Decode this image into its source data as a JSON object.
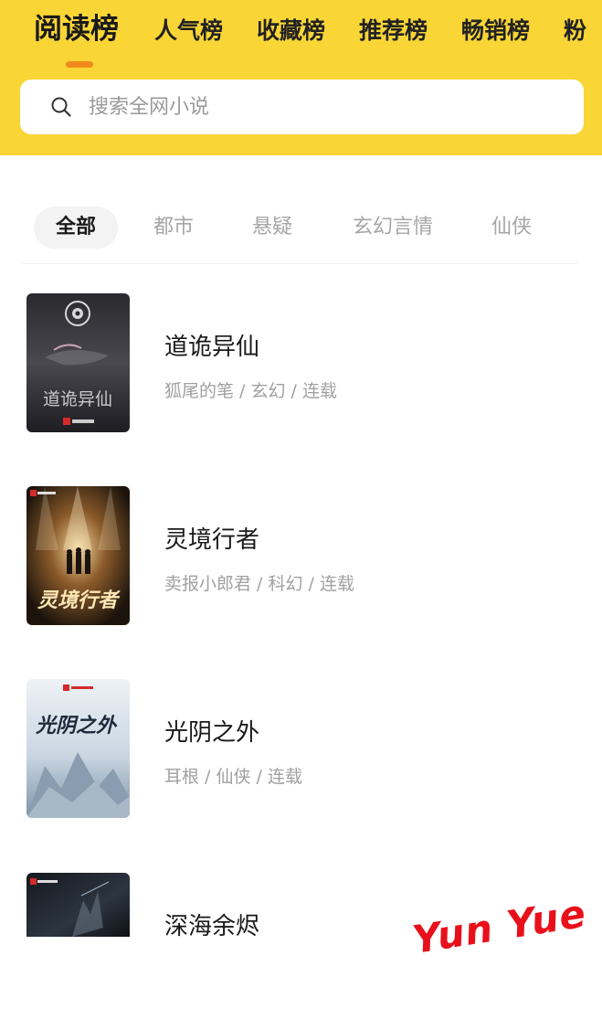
{
  "top_tabs": [
    {
      "label": "阅读榜",
      "active": true
    },
    {
      "label": "人气榜",
      "active": false
    },
    {
      "label": "收藏榜",
      "active": false
    },
    {
      "label": "推荐榜",
      "active": false
    },
    {
      "label": "畅销榜",
      "active": false
    },
    {
      "label": "粉",
      "active": false
    }
  ],
  "search": {
    "placeholder": "搜索全网小说",
    "icon": "search-icon"
  },
  "filters": [
    {
      "label": "全部",
      "active": true
    },
    {
      "label": "都市",
      "active": false
    },
    {
      "label": "悬疑",
      "active": false
    },
    {
      "label": "玄幻言情",
      "active": false
    },
    {
      "label": "仙侠",
      "active": false
    }
  ],
  "books": [
    {
      "title": "道诡异仙",
      "meta": "狐尾的笔 / 玄幻 / 连载",
      "cover_text": "道诡异仙"
    },
    {
      "title": "灵境行者",
      "meta": "卖报小郎君 / 科幻 / 连载",
      "cover_text": "灵境行者"
    },
    {
      "title": "光阴之外",
      "meta": "耳根 / 仙侠 / 连载",
      "cover_text": "光阴之外"
    },
    {
      "title": "深海余烬",
      "meta": "",
      "cover_text": ""
    }
  ],
  "watermark": "Yun Yue",
  "colors": {
    "header_bg": "#f9d536",
    "tab_indicator": "#f08a1c",
    "watermark": "#e8101a"
  }
}
